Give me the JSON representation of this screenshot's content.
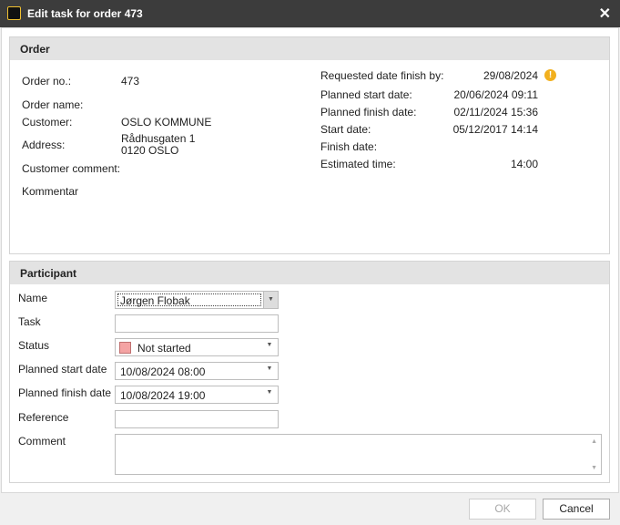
{
  "window": {
    "title": "Edit task for order 473",
    "close_icon": "close-icon"
  },
  "order": {
    "header": "Order",
    "order_no_label": "Order no.:",
    "order_no": "473",
    "order_name_label": "Order name:",
    "order_name": "",
    "customer_label": "Customer:",
    "customer": "OSLO KOMMUNE",
    "address_label": "Address:",
    "address": "Rådhusgaten 1\n0120 OSLO",
    "customer_comment_label": "Customer comment:",
    "kommentar_label": "Kommentar",
    "requested_label": "Requested date finish by:",
    "requested": "29/08/2024",
    "planned_start_label": "Planned start date:",
    "planned_start": "20/06/2024 09:11",
    "planned_finish_label": "Planned finish date:",
    "planned_finish": "02/11/2024 15:36",
    "start_label": "Start date:",
    "start": "05/12/2017 14:14",
    "finish_label": "Finish date:",
    "finish": "",
    "estimated_label": "Estimated time:",
    "estimated": "14:00",
    "warning_icon": "warning-icon",
    "warning_symbol": "!"
  },
  "participant": {
    "header": "Participant",
    "name_label": "Name",
    "name": "Jørgen Flobak",
    "task_label": "Task",
    "task": "",
    "status_label": "Status",
    "status": "Not started",
    "status_color": "#f4a3a3",
    "planned_start_label": "Planned start date",
    "planned_start": "10/08/2024 08:00",
    "planned_finish_label": "Planned finish date",
    "planned_finish": "10/08/2024 19:00",
    "reference_label": "Reference",
    "reference": "",
    "comment_label": "Comment",
    "comment": ""
  },
  "buttons": {
    "ok": "OK",
    "cancel": "Cancel"
  }
}
